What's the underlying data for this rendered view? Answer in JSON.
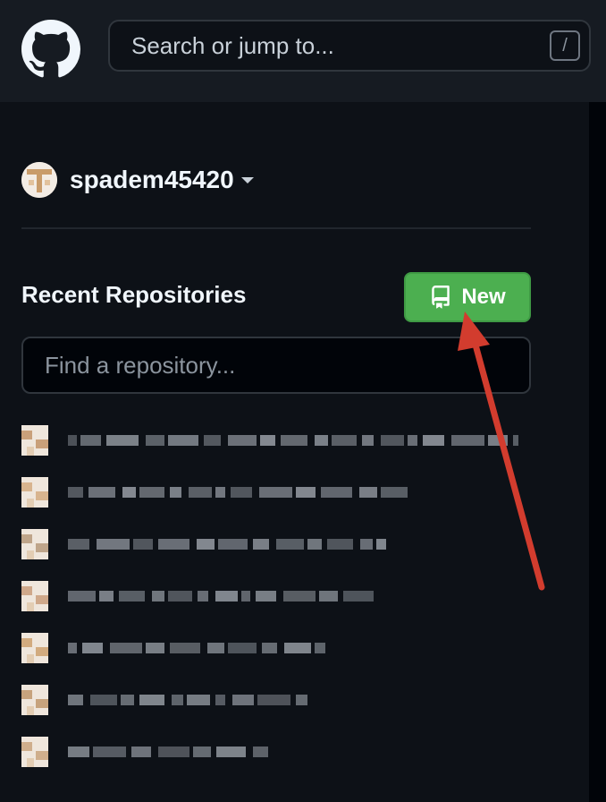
{
  "header": {
    "logo_icon": "github-mark-icon",
    "search": {
      "placeholder": "Search or jump to...",
      "shortcut": "/"
    }
  },
  "account": {
    "username": "spadem45420",
    "avatar_icon": "identicon-avatar",
    "dropdown_icon": "caret-down-icon"
  },
  "recent_repos": {
    "title": "Recent Repositories",
    "new_button": {
      "label": "New",
      "icon": "repo-icon"
    },
    "filter_placeholder": "Find a repository...",
    "items": [
      {
        "name_blurred": true
      },
      {
        "name_blurred": true
      },
      {
        "name_blurred": true
      },
      {
        "name_blurred": true
      },
      {
        "name_blurred": true
      },
      {
        "name_blurred": true
      },
      {
        "name_blurred": true
      }
    ]
  },
  "annotation": {
    "type": "red-arrow",
    "color": "#d23c2e",
    "points_to": "new-button"
  },
  "colors": {
    "background": "#0d1117",
    "header": "#161b22",
    "new_button": "#4caf50",
    "text": "#f0f6fc"
  }
}
